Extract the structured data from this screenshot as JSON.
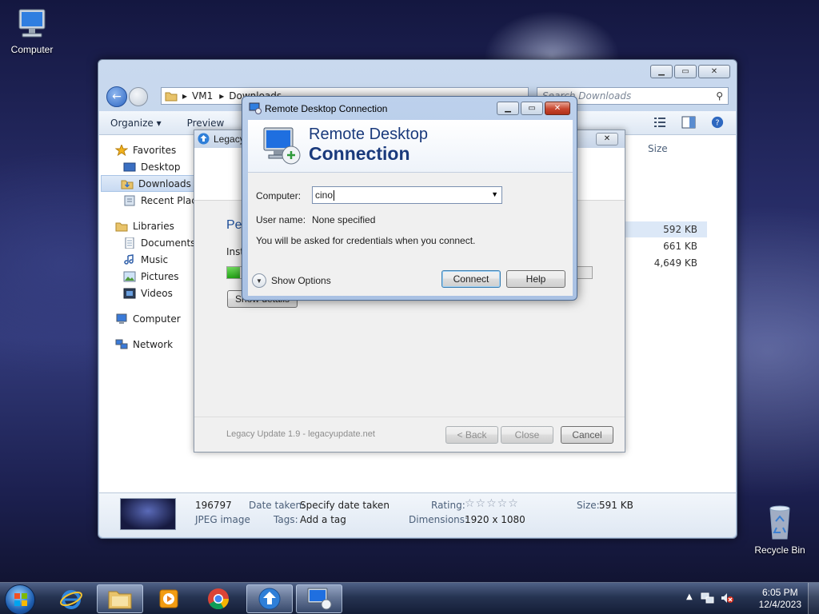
{
  "desktop": {
    "icons": [
      {
        "label": "Computer",
        "icon": "computer-icon"
      },
      {
        "label": "Recycle Bin",
        "icon": "recycle-bin-icon"
      }
    ]
  },
  "explorer": {
    "address": {
      "segment1": "VM1",
      "segment2": "Downloads"
    },
    "search_placeholder": "Search Downloads",
    "toolbar": {
      "organize": "Organize",
      "preview": "Preview"
    },
    "nav": {
      "favorites": "Favorites",
      "desktop": "Desktop",
      "downloads": "Downloads",
      "recent": "Recent Places",
      "libraries": "Libraries",
      "documents": "Documents",
      "music": "Music",
      "pictures": "Pictures",
      "videos": "Videos",
      "computer": "Computer",
      "network": "Network"
    },
    "column_size": "Size",
    "sizes": [
      "592 KB",
      "661 KB",
      "4,649 KB"
    ],
    "truncated_name": "...",
    "details": {
      "name": "196797",
      "type": "JPEG image",
      "date_label": "Date taken:",
      "date_value": "Specify date taken",
      "tags_label": "Tags:",
      "tags_value": "Add a tag",
      "rating_label": "Rating:",
      "rating_stars": "☆☆☆☆☆",
      "dimensions_label": "Dimensions:",
      "dimensions_value": "1920 x 1080",
      "size_label": "Size:",
      "size_value": "591 KB"
    }
  },
  "legacy_update": {
    "title": "Legacy Update",
    "heading": "Pe",
    "install_label": "Inst",
    "progress_percent": 3.5,
    "show_details": "Show details",
    "footer": "Legacy Update 1.9 - legacyupdate.net",
    "back": "< Back",
    "close": "Close",
    "cancel": "Cancel"
  },
  "rdp": {
    "window_title": "Remote Desktop Connection",
    "heading_line1": "Remote Desktop",
    "heading_line2": "Connection",
    "computer_label": "Computer:",
    "computer_value": "cino",
    "username_label": "User name:",
    "username_value": "None specified",
    "info": "You will be asked for credentials when you connect.",
    "show_options": "Show Options",
    "connect": "Connect",
    "help": "Help"
  },
  "taskbar": {
    "time": "6:05 PM",
    "date": "12/4/2023"
  }
}
